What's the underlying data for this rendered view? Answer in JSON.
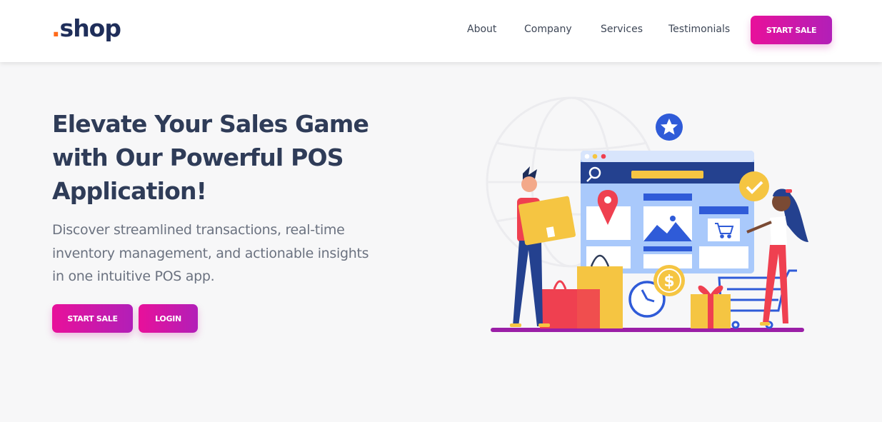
{
  "brand": {
    "prefix": ".",
    "name": "shop"
  },
  "nav": {
    "links": [
      "About",
      "Company",
      "Services",
      "Testimonials"
    ],
    "cta_label": "START SALE"
  },
  "hero": {
    "title": "Elevate Your Sales Game with Our Powerful POS Application!",
    "description": "Discover streamlined transactions, real-time inventory management, and actionable insights in one intuitive POS app.",
    "primary_button": "START SALE",
    "secondary_button": "LOGIN"
  },
  "colors": {
    "brand_navy": "#1f2e5a",
    "brand_orange": "#ff6a1a",
    "gradient_start": "#e8109a",
    "gradient_end": "#b21fb8",
    "page_background": "#f7f7f8"
  },
  "illustration": {
    "icons": [
      "star-icon",
      "search-icon",
      "location-pin-icon",
      "image-icon",
      "cart-icon",
      "checkmark-icon",
      "dollar-coin-icon",
      "clock-icon",
      "gift-icon"
    ]
  }
}
